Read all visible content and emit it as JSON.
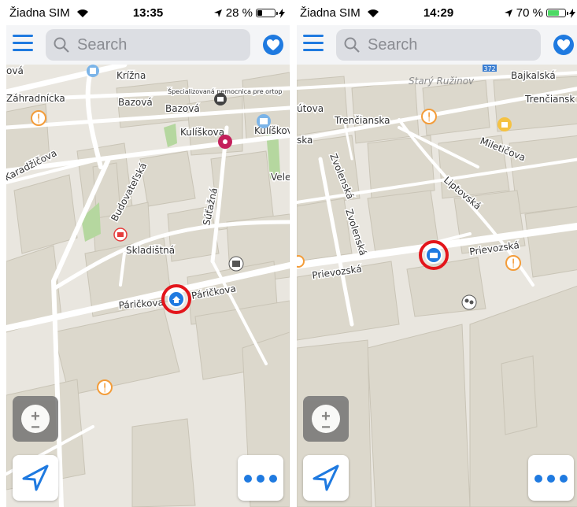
{
  "screens": [
    {
      "status": {
        "carrier": "Žiadna SIM",
        "time": "13:35",
        "battery": "28 %",
        "battery_level": 0.28,
        "battery_color": "#000000"
      },
      "search": {
        "placeholder": "Search"
      },
      "streets": {
        "krizna": "Krížna",
        "zahradnicka": "Záhradnícka",
        "bazova1": "Bazová",
        "bazova2": "Bazová",
        "kuliskova1": "Kulíškova",
        "kuliskova2": "Kulíškov",
        "karadzicova": "Karadžičova",
        "budovatelska": "Budovateľská",
        "sutazna": "Súťažná",
        "skladistna": "Skladištná",
        "parickova1": "Páričkova",
        "parickova2": "Páričkova",
        "specialized": "Špecializovaná nemocnica pre ortop",
        "va": "ová",
        "vele": "Vele"
      }
    },
    {
      "status": {
        "carrier": "Žiadna SIM",
        "time": "14:29",
        "battery": "70 %",
        "battery_level": 0.7,
        "battery_color": "#4cd964"
      },
      "search": {
        "placeholder": "Search"
      },
      "streets": {
        "stary_ruzinov": "Starý Ružinov",
        "bajkalska": "Bajkalská",
        "trencianska1": "Trenčianska",
        "trencianska2": "Trenčiansk",
        "utova": "útova",
        "ska": "ska",
        "zvolenska1": "Zvolenská",
        "zvolenska2": "Zvolenská",
        "mileticova": "Miletičova",
        "liptovska": "Liptovská",
        "prievozska1": "Prievozská",
        "prievozska2": "Prievozská",
        "road_badge": "372"
      }
    }
  ],
  "colors": {
    "accent": "#1f7ae0",
    "highlight_ring": "#e3151b",
    "map_bg": "#e9e6df",
    "building": "#dcd8cc",
    "park": "#b5d79f"
  },
  "icons": [
    "menu-icon",
    "search-icon",
    "favorites-heart-icon",
    "zoom-icon",
    "navigation-arrow-icon",
    "more-icon",
    "home-icon",
    "work-icon",
    "restaurant-icon",
    "museum-icon",
    "hospital-icon",
    "theatre-icon",
    "like-icon",
    "community-icon"
  ]
}
